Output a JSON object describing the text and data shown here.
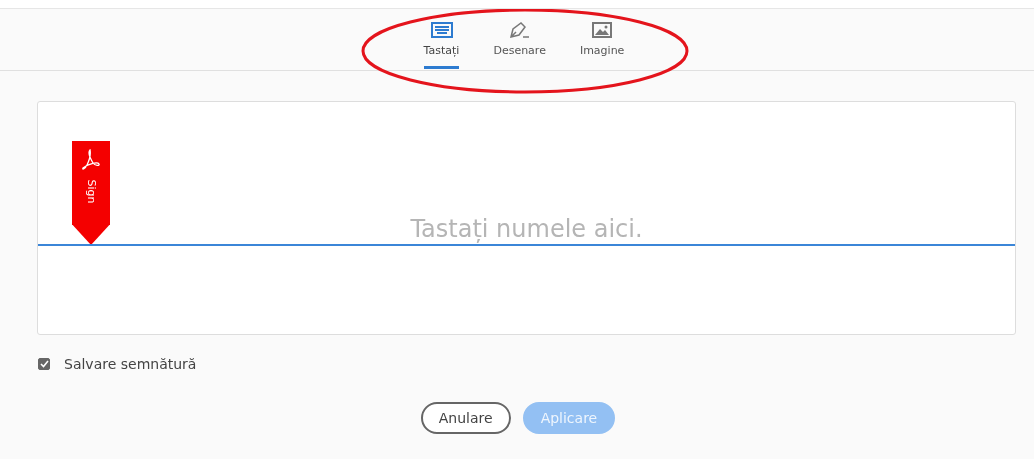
{
  "tabs": [
    {
      "kind": "keyboard",
      "label": "Tastați",
      "selected": true
    },
    {
      "kind": "pen",
      "label": "Desenare",
      "selected": false
    },
    {
      "kind": "image",
      "label": "Imagine",
      "selected": false
    }
  ],
  "sign_tag": {
    "label": "Sign"
  },
  "name_field": {
    "placeholder": "Tastați numele aici."
  },
  "save_signature": {
    "label": "Salvare semnătură",
    "checked": true
  },
  "buttons": [
    {
      "kind": "secondary",
      "label": "Anulare",
      "disabled": false
    },
    {
      "kind": "primary",
      "label": "Aplicare",
      "disabled": true
    }
  ]
}
